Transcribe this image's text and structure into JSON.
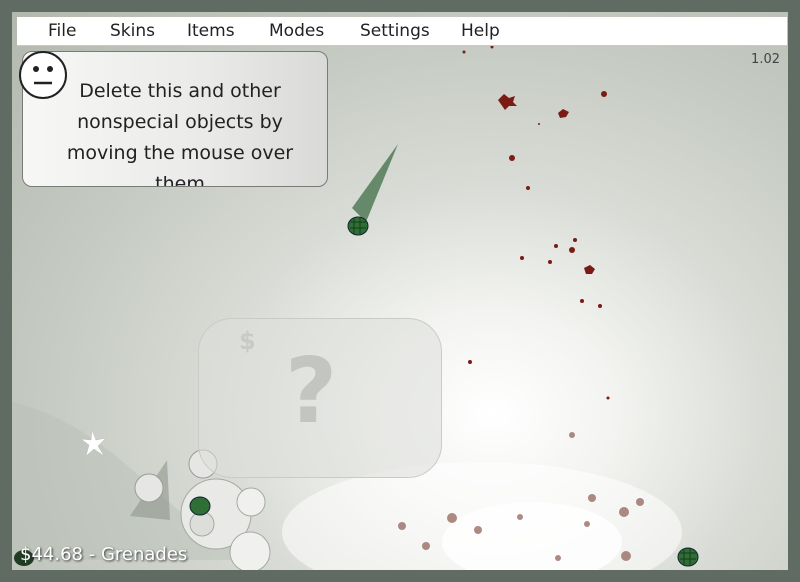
{
  "menu": {
    "file": "File",
    "skins": "Skins",
    "items": "Items",
    "modes": "Modes",
    "settings": "Settings",
    "help": "Help"
  },
  "version": "1.02",
  "tip": {
    "text": "Delete this and other nonspecial objects by moving the mouse over them",
    "face_icon": "neutral-face-icon"
  },
  "shop_panel": {
    "currency_symbol": "$",
    "mystery_symbol": "?"
  },
  "status": {
    "money": "$44.68",
    "separator": "-",
    "item": "Grenades"
  },
  "colors": {
    "frame": "#5f6b63",
    "grenade": "#2f6e35",
    "blood": "#7a1c14"
  }
}
